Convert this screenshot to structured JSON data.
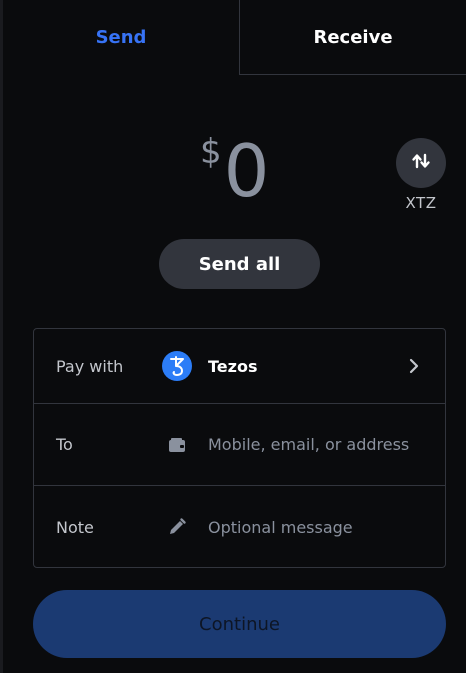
{
  "tabs": {
    "send": "Send",
    "receive": "Receive"
  },
  "amount": {
    "currency_symbol": "$",
    "value": "0"
  },
  "swap": {
    "icon": "swap-vertical-icon",
    "asset_code": "XTZ"
  },
  "send_all_label": "Send all",
  "form": {
    "pay_with": {
      "label": "Pay with",
      "asset_name": "Tezos",
      "asset_icon": "tezos-logo-icon"
    },
    "to": {
      "label": "To",
      "placeholder": "Mobile, email, or address",
      "icon": "wallet-icon"
    },
    "note": {
      "label": "Note",
      "placeholder": "Optional message",
      "icon": "pencil-icon"
    }
  },
  "continue_label": "Continue",
  "colors": {
    "background": "#0a0b0d",
    "accent": "#3773f5",
    "surface": "#32353d",
    "continue_disabled": "#1b3a72",
    "tezos_blue": "#2c7df7"
  }
}
